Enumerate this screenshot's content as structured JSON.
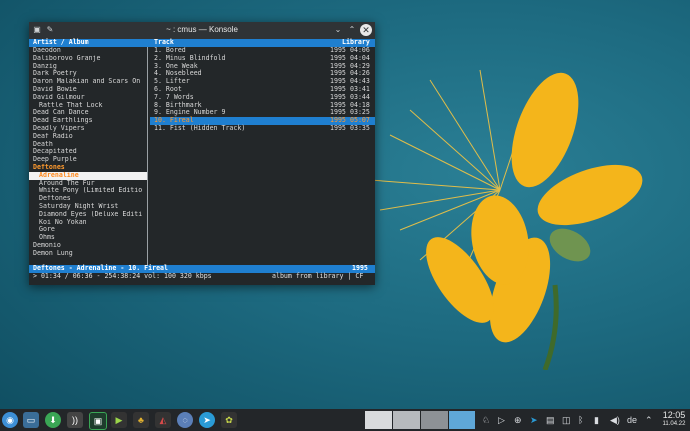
{
  "window": {
    "title": "~ : cmus — Konsole"
  },
  "cmus": {
    "col_artist": "Artist / Album",
    "col_track": "Track",
    "col_library": "Library",
    "artists": [
      {
        "label": "Daeodon",
        "kind": "artist"
      },
      {
        "label": "Daliborovo Granje",
        "kind": "artist"
      },
      {
        "label": "Danzig",
        "kind": "artist"
      },
      {
        "label": "Dark Poetry",
        "kind": "artist"
      },
      {
        "label": "Daron Malakian and Scars On",
        "kind": "artist"
      },
      {
        "label": "David Bowie",
        "kind": "artist"
      },
      {
        "label": "David Gilmour",
        "kind": "artist"
      },
      {
        "label": "Rattle That Lock",
        "kind": "album"
      },
      {
        "label": "Dead Can Dance",
        "kind": "artist"
      },
      {
        "label": "Dead Earthlings",
        "kind": "artist"
      },
      {
        "label": "Deadly Vipers",
        "kind": "artist"
      },
      {
        "label": "Deaf Radio",
        "kind": "artist"
      },
      {
        "label": "Death",
        "kind": "artist"
      },
      {
        "label": "Decapitated",
        "kind": "artist"
      },
      {
        "label": "Deep Purple",
        "kind": "artist"
      },
      {
        "label": "Deftones",
        "kind": "current"
      },
      {
        "label": "Adrenaline",
        "kind": "selected"
      },
      {
        "label": "Around The Fur",
        "kind": "album"
      },
      {
        "label": "White Pony (Limited Editio",
        "kind": "album"
      },
      {
        "label": "Deftones",
        "kind": "album"
      },
      {
        "label": "Saturday Night Wrist",
        "kind": "album"
      },
      {
        "label": "Diamond Eyes (Deluxe Editi",
        "kind": "album"
      },
      {
        "label": "Koi No Yokan",
        "kind": "album"
      },
      {
        "label": "Gore",
        "kind": "album"
      },
      {
        "label": "Ohms",
        "kind": "album"
      },
      {
        "label": "Demonio",
        "kind": "artist"
      },
      {
        "label": "Demon Lung",
        "kind": "artist"
      }
    ],
    "tracks": [
      {
        "name": "1. Bored",
        "year": "1995",
        "dur": "04:06"
      },
      {
        "name": "2. Minus Blindfold",
        "year": "1995",
        "dur": "04:04"
      },
      {
        "name": "3. One Weak",
        "year": "1995",
        "dur": "04:29"
      },
      {
        "name": "4. Nosebleed",
        "year": "1995",
        "dur": "04:26"
      },
      {
        "name": "5. Lifter",
        "year": "1995",
        "dur": "04:43"
      },
      {
        "name": "6. Root",
        "year": "1995",
        "dur": "03:41"
      },
      {
        "name": "7. 7 Words",
        "year": "1995",
        "dur": "03:44"
      },
      {
        "name": "8. Birthmark",
        "year": "1995",
        "dur": "04:18"
      },
      {
        "name": "9. Engine Number 9",
        "year": "1995",
        "dur": "03:25"
      },
      {
        "name": "10. Fireal",
        "year": "1995",
        "dur": "05:07",
        "selected": true
      },
      {
        "name": "11. Fist (Hidden Track)",
        "year": "1995",
        "dur": "03:35"
      }
    ],
    "now_playing": "Deftones - Adrenaline - 10. Fireal",
    "now_playing_year": "1995",
    "status_left": "> 01:34 / 06:36 - 254:38:24 vol: 100  320 kbps",
    "status_right": "album from library | CF"
  },
  "taskbar": {
    "apps": [
      "app-launcher-icon",
      "desktop-icon",
      "store-icon",
      "rss-icon",
      "terminal-icon",
      "media-player-icon",
      "file-manager-icon",
      "audio-editor-icon",
      "browser-icon",
      "telegram-icon",
      "emulator-icon"
    ],
    "language": "de",
    "time": "12:05",
    "date": "11.04.22"
  }
}
